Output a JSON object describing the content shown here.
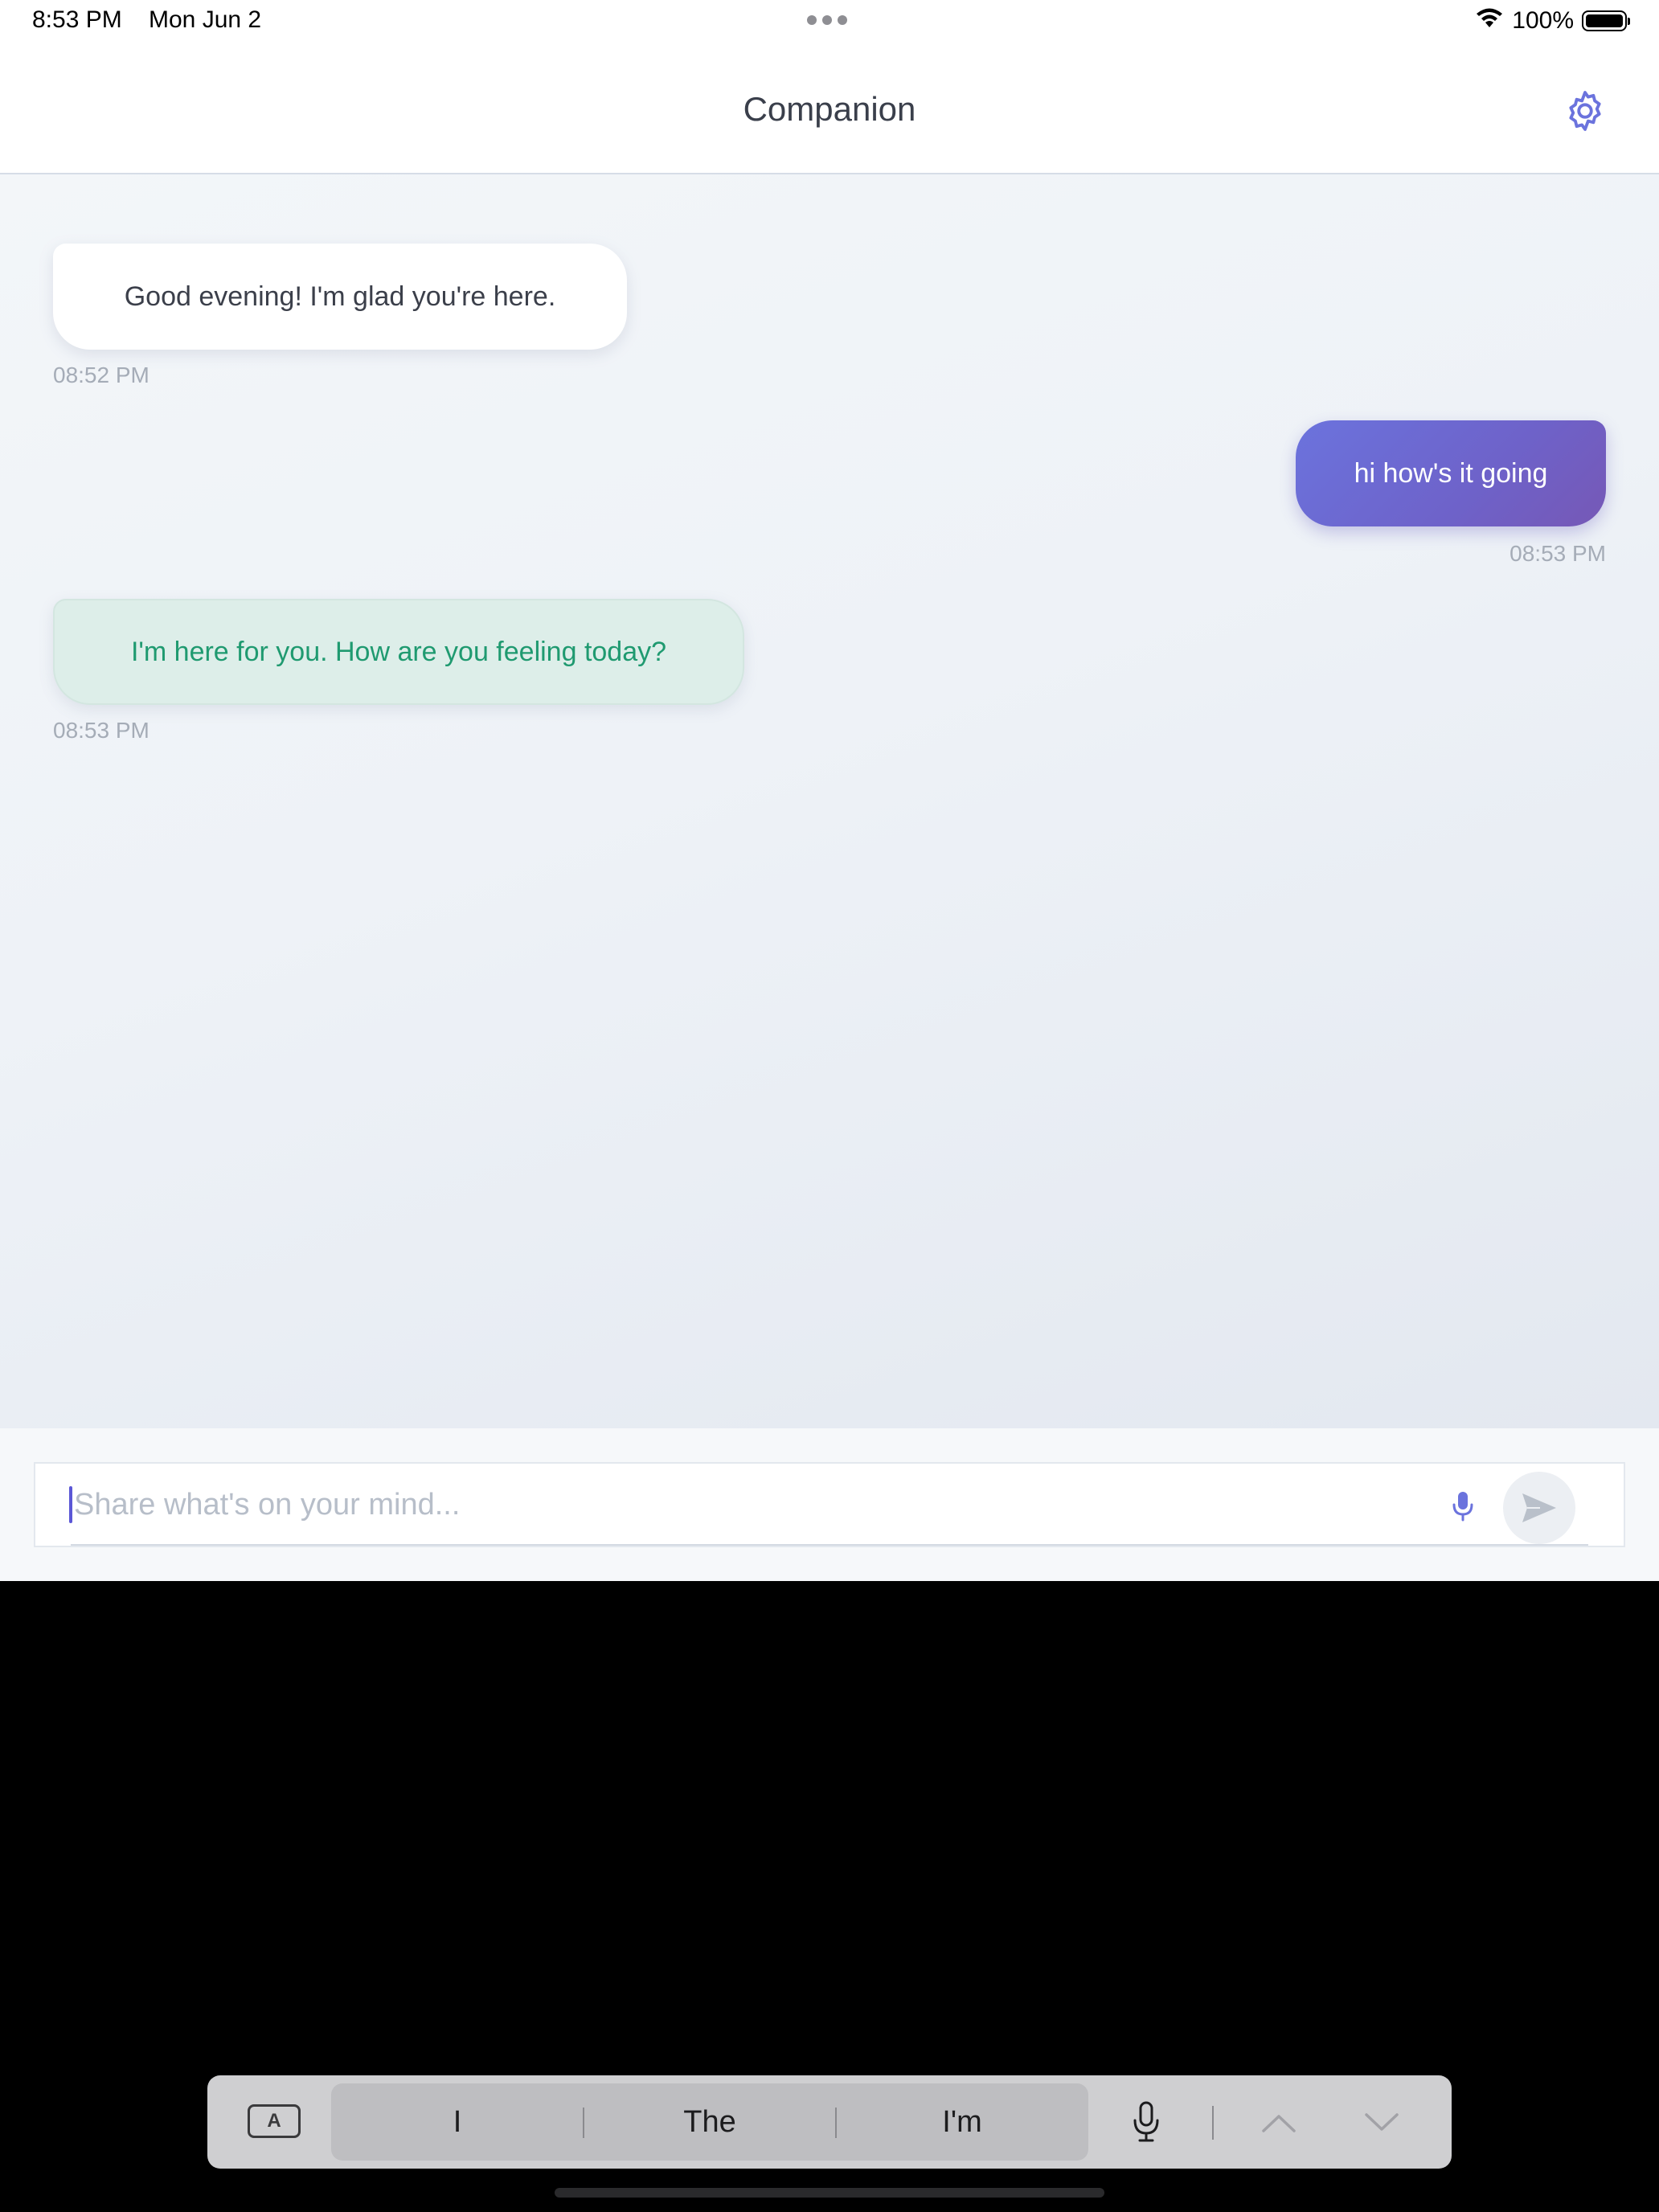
{
  "status": {
    "time": "8:53 PM",
    "date": "Mon Jun 2",
    "battery": "100%"
  },
  "header": {
    "title": "Companion",
    "settings_icon": "gear-icon",
    "accent": "#6b73dd"
  },
  "messages": [
    {
      "sender": "companion",
      "text": "Good evening! I'm glad you're here.",
      "time": "08:52 PM"
    },
    {
      "sender": "user",
      "text": "hi how's it going",
      "time": "08:53 PM"
    },
    {
      "sender": "companion",
      "text": "I'm here for you. How are you feeling today?",
      "time": "08:53 PM"
    }
  ],
  "composer": {
    "placeholder": "Share what's on your mind...",
    "value": "",
    "mic_icon": "microphone-icon",
    "send_icon": "send-icon"
  },
  "keyboard": {
    "format_label": "A",
    "suggestions": [
      "I",
      "The",
      "I'm"
    ]
  },
  "colors": {
    "user_bubble": "#6b73dd",
    "reply_bubble": "#ddeee9",
    "reply_text": "#1f9a70"
  }
}
